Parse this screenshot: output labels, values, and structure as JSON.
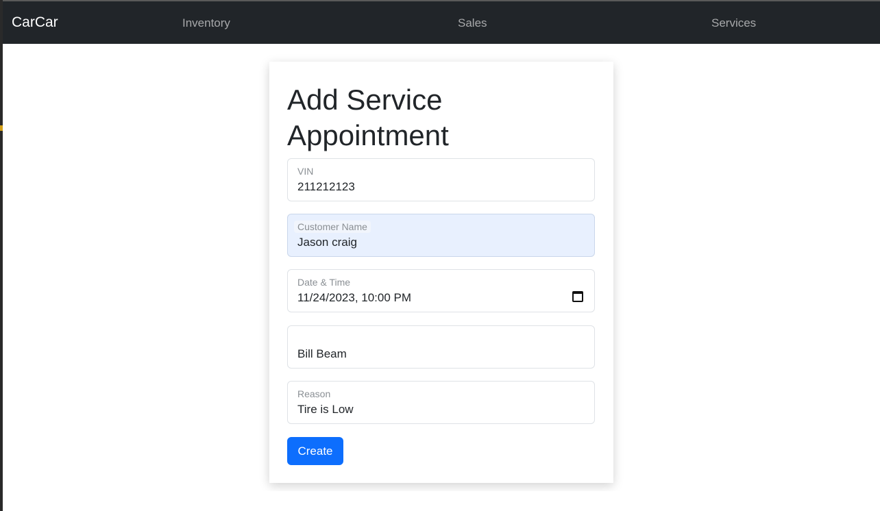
{
  "navbar": {
    "brand": "CarCar",
    "links": [
      "Inventory",
      "Sales",
      "Services"
    ]
  },
  "form": {
    "title": "Add Service Appointment",
    "fields": {
      "vin": {
        "label": "VIN",
        "value": "211212123"
      },
      "customer": {
        "label": "Customer Name",
        "value": "Jason craig"
      },
      "date_time": {
        "label": "Date & Time",
        "value": "11/24/2023, 10:00 PM"
      },
      "technician": {
        "label": "",
        "value": "Bill Beam"
      },
      "reason": {
        "label": "Reason",
        "value": "Tire is Low"
      }
    },
    "submit_label": "Create"
  },
  "colors": {
    "navbar_bg": "#212529",
    "primary": "#0d6efd",
    "autofill_bg": "#e8f0fe"
  },
  "icons": {
    "date_picker": "calendar-icon"
  }
}
